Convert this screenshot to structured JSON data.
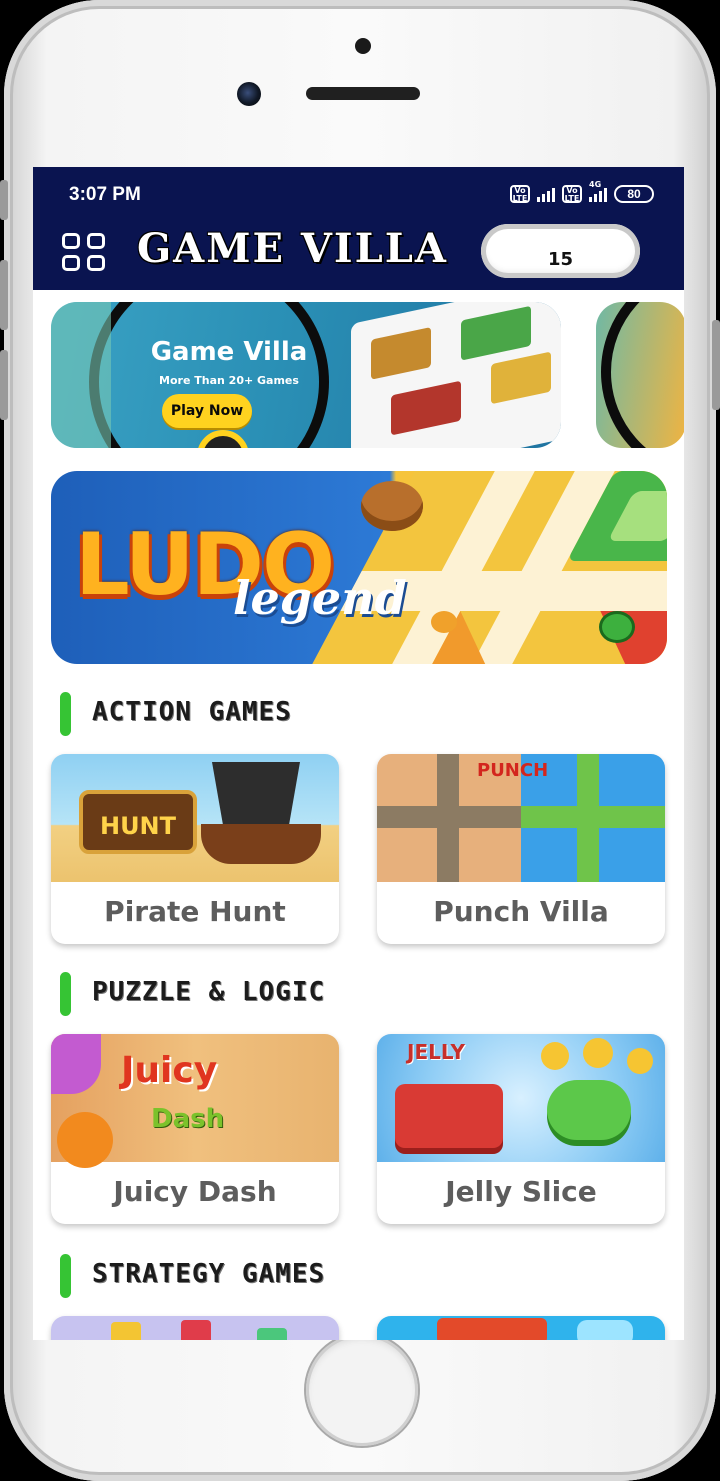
{
  "status_bar": {
    "time": "3:07 PM",
    "net1": "Vo LTE",
    "net2": "Vo LTE",
    "net_type": "4G",
    "battery": "80"
  },
  "app_bar": {
    "title": "GAME VILLA",
    "coins": "15"
  },
  "carousel": [
    {
      "title": "Game Villa",
      "subtitle": "More Than 20+ Games",
      "button": "Play Now"
    }
  ],
  "featured": {
    "title": "LUDO",
    "subtitle": "legend"
  },
  "sections": [
    {
      "title": "ACTION GAMES",
      "games": [
        "Pirate Hunt",
        "Punch Villa"
      ]
    },
    {
      "title": "PUZZLE & LOGIC",
      "games": [
        "Juicy Dash",
        "Jelly Slice"
      ]
    },
    {
      "title": "STRATEGY GAMES",
      "games": []
    }
  ],
  "colors": {
    "app_bar": "#0a1450",
    "section_accent": "#36c434",
    "play_button": "#ffd21f"
  }
}
